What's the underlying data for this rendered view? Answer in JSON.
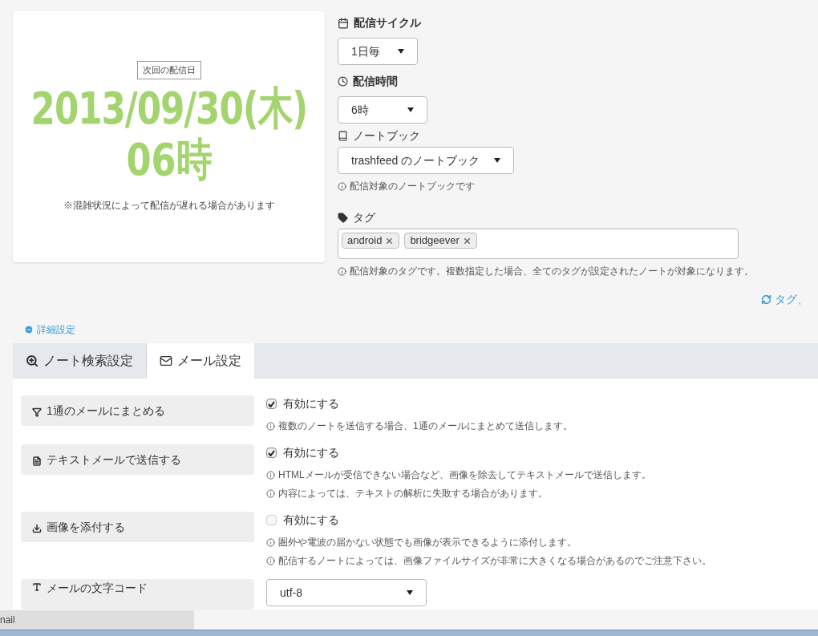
{
  "next_delivery": {
    "badge": "次回の配信日",
    "date": "2013/09/30(木)",
    "hour": "06時",
    "note": "※混雑状況によって配信が遅れる場合があります"
  },
  "cycle": {
    "label": "配信サイクル",
    "value": "1日毎"
  },
  "time": {
    "label": "配信時間",
    "value": "6時"
  },
  "notebook": {
    "label": "ノートブック",
    "value": "trashfeed のノートブック",
    "help": "配信対象のノートブックです"
  },
  "tags": {
    "label": "タグ",
    "items": [
      "android",
      "bridgeever"
    ],
    "help": "配信対象のタグです。複数指定した場合、全てのタグが設定されたノートが対象になります。"
  },
  "refresh_link": "タグ、",
  "advanced_toggle": {
    "label": "詳細設定",
    "expanded": true
  },
  "tabs": [
    {
      "label": "ノート検索設定",
      "kind": "search",
      "selected": false
    },
    {
      "label": "メール設定",
      "kind": "mail",
      "selected": true
    }
  ],
  "settings": [
    {
      "kind": "checkbox",
      "label": "1通のメールにまとめる",
      "option": "有効にする",
      "checked": true,
      "help": [
        "複数のノートを送信する場合、1通のメールにまとめて送信します。"
      ]
    },
    {
      "kind": "checkbox",
      "label": "テキストメールで送信する",
      "option": "有効にする",
      "checked": true,
      "help": [
        "HTMLメールが受信できない場合など、画像を除去してテキストメールで送信します。",
        "内容によっては、テキストの解析に失敗する場合があります。"
      ]
    },
    {
      "kind": "checkbox",
      "label": "画像を添付する",
      "option": "有効にする",
      "checked": false,
      "help": [
        "圏外や電波の届かない状態でも画像が表示できるように添付します。",
        "配信するノートによっては、画像ファイルサイズが非常に大きくなる場合があるのでご注意下さい。"
      ]
    },
    {
      "kind": "select",
      "label": "メールの文字コード",
      "value": "utf-8"
    }
  ],
  "status_tooltip": "nail"
}
